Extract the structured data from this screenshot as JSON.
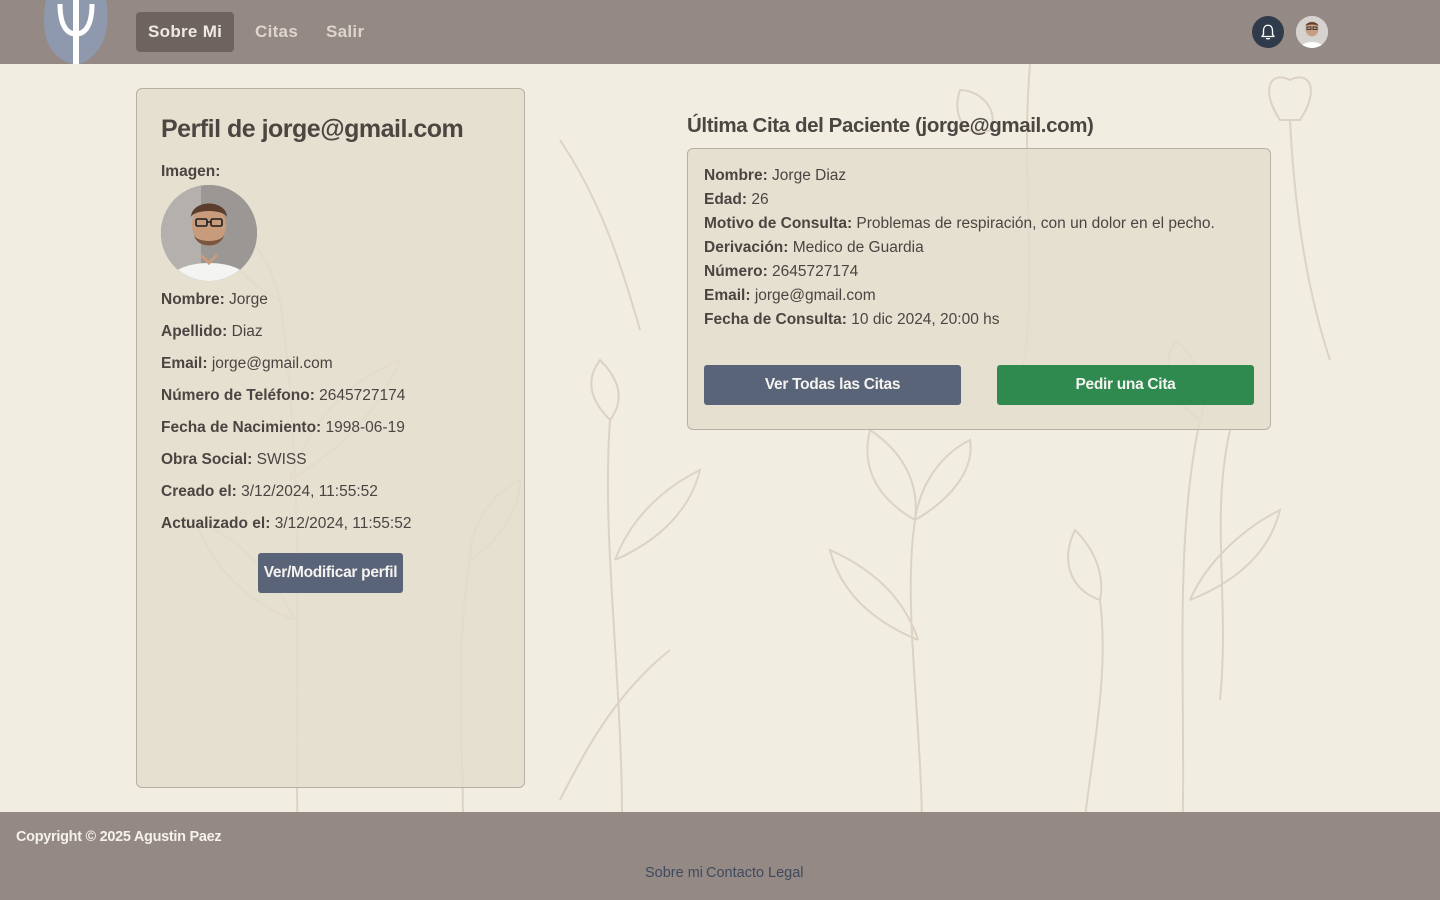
{
  "nav": {
    "items": [
      {
        "label": "Sobre Mi",
        "active": true
      },
      {
        "label": "Citas",
        "active": false
      },
      {
        "label": "Salir",
        "active": false
      }
    ],
    "bell_icon": "bell-icon",
    "logo_icon": "psi-logo-icon"
  },
  "profile": {
    "title": "Perfil de jorge@gmail.com",
    "image_label": "Imagen:",
    "fields": [
      {
        "label": "Nombre:",
        "value": "Jorge"
      },
      {
        "label": "Apellido:",
        "value": "Diaz"
      },
      {
        "label": "Email:",
        "value": "jorge@gmail.com"
      },
      {
        "label": "Número de Teléfono:",
        "value": "2645727174"
      },
      {
        "label": "Fecha de Nacimiento:",
        "value": "1998-06-19"
      },
      {
        "label": "Obra Social:",
        "value": "SWISS"
      },
      {
        "label": "Creado el:",
        "value": "3/12/2024, 11:55:52"
      },
      {
        "label": "Actualizado el:",
        "value": "3/12/2024, 11:55:52"
      }
    ],
    "edit_button": "Ver/Modificar perfil"
  },
  "appointment": {
    "title": "Última Cita del Paciente (jorge@gmail.com)",
    "fields": [
      {
        "label": "Nombre:",
        "value": "Jorge Diaz"
      },
      {
        "label": "Edad:",
        "value": "26"
      },
      {
        "label": "Motivo de Consulta:",
        "value": "Problemas de respiración, con un dolor en el pecho."
      },
      {
        "label": "Derivación:",
        "value": "Medico de Guardia"
      },
      {
        "label": "Número:",
        "value": "2645727174"
      },
      {
        "label": "Email:",
        "value": "jorge@gmail.com"
      },
      {
        "label": "Fecha de Consulta:",
        "value": "10 dic 2024, 20:00 hs"
      }
    ],
    "view_all_button": "Ver Todas las Citas",
    "request_button": "Pedir una Cita"
  },
  "footer": {
    "copyright": "Copyright © 2025 Agustin Paez",
    "links": [
      "Sobre mi",
      "Contacto",
      "Legal"
    ]
  },
  "colors": {
    "navbar": "#948984",
    "page_background": "#f1ede1",
    "button_slate": "#5a6478",
    "button_green": "#2e8a4f"
  }
}
